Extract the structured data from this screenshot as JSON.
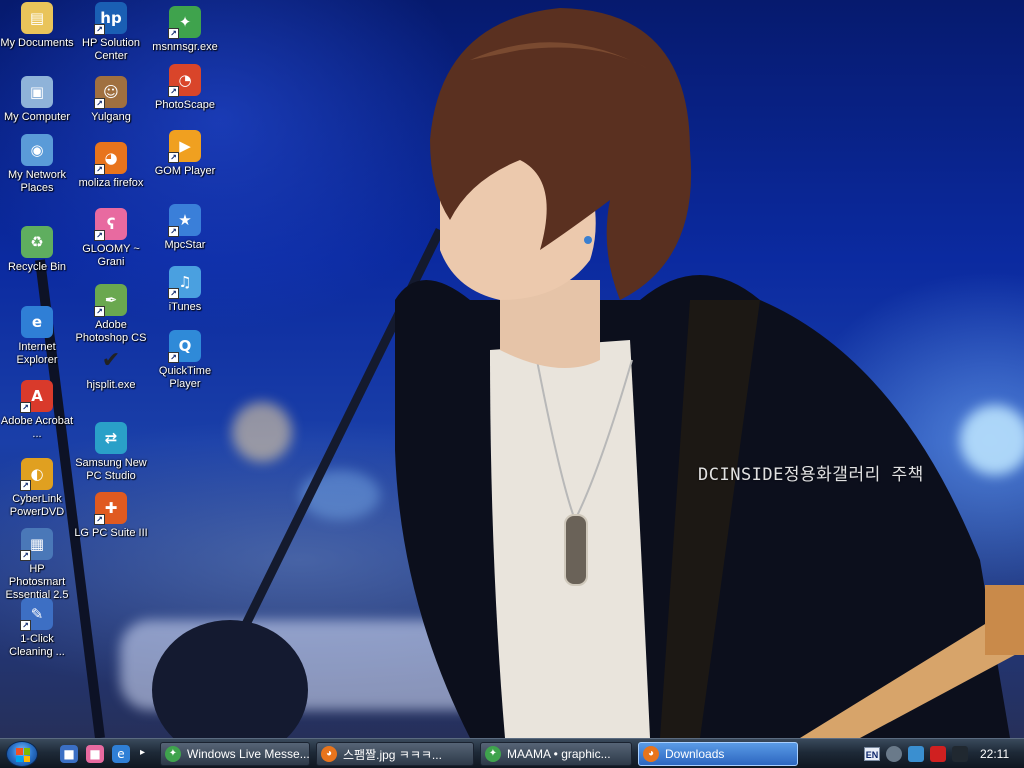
{
  "desktop": {
    "watermark": "DCINSIDE정용화갤러리 주책",
    "icons": [
      {
        "label": "My Documents",
        "icon": "folder-document-icon",
        "color": "#e9c45a",
        "shortcut": false
      },
      {
        "label": "My Computer",
        "icon": "computer-icon",
        "color": "#8fb3d9",
        "shortcut": false
      },
      {
        "label": "My Network Places",
        "icon": "network-icon",
        "color": "#5a9bd8",
        "shortcut": false
      },
      {
        "label": "Recycle Bin",
        "icon": "recycle-bin-icon",
        "color": "#5fae5f",
        "shortcut": false
      },
      {
        "label": "Internet Explorer",
        "icon": "internet-explorer-icon",
        "color": "#2f7fd6",
        "shortcut": false
      },
      {
        "label": "Adobe Acrobat ...",
        "icon": "acrobat-icon",
        "color": "#d93a2b",
        "shortcut": true
      },
      {
        "label": "CyberLink PowerDVD",
        "icon": "powerdvd-icon",
        "color": "#e0a020",
        "shortcut": true
      },
      {
        "label": "HP Photosmart Essential 2.5",
        "icon": "hp-photosmart-icon",
        "color": "#4a78b8",
        "shortcut": true
      },
      {
        "label": "1-Click Cleaning ...",
        "icon": "cleaning-brush-icon",
        "color": "#3d6fc4",
        "shortcut": true
      },
      {
        "label": "HP Solution Center",
        "icon": "hp-logo-icon",
        "color": "#1a5fb4",
        "shortcut": true
      },
      {
        "label": "Yulgang",
        "icon": "game-character-icon",
        "color": "#a07040",
        "shortcut": true
      },
      {
        "label": "moliza firefox",
        "icon": "firefox-icon",
        "color": "#e8741c",
        "shortcut": true
      },
      {
        "label": "GLOOMY ~ Grani",
        "icon": "pink-bear-icon",
        "color": "#e86aa0",
        "shortcut": true
      },
      {
        "label": "Adobe Photoshop CS",
        "icon": "photoshop-feather-icon",
        "color": "#6aa84f",
        "shortcut": true
      },
      {
        "label": "hjsplit.exe",
        "icon": "checkmark-icon",
        "color": "#222222",
        "shortcut": false
      },
      {
        "label": "Samsung New PC Studio",
        "icon": "samsung-pc-studio-icon",
        "color": "#2aa0c8",
        "shortcut": false
      },
      {
        "label": "LG PC Suite III",
        "icon": "lg-pc-suite-icon",
        "color": "#e05a20",
        "shortcut": true
      },
      {
        "label": "msnmsgr.exe",
        "icon": "msn-messenger-icon",
        "color": "#3fa34d",
        "shortcut": true
      },
      {
        "label": "PhotoScape",
        "icon": "photoscape-icon",
        "color": "#d9452a",
        "shortcut": true
      },
      {
        "label": "GOM Player",
        "icon": "gom-player-icon",
        "color": "#f0a020",
        "shortcut": true
      },
      {
        "label": "MpcStar",
        "icon": "mpcstar-icon",
        "color": "#3a7fd9",
        "shortcut": true
      },
      {
        "label": "iTunes",
        "icon": "itunes-icon",
        "color": "#4aa0e0",
        "shortcut": true
      },
      {
        "label": "QuickTime Player",
        "icon": "quicktime-icon",
        "color": "#2f8ad8",
        "shortcut": true
      }
    ]
  },
  "taskbar": {
    "start_icon": "windows-orb-icon",
    "quick_launch": [
      {
        "icon": "show-desktop-icon",
        "color": "#3b6fc4"
      },
      {
        "icon": "gloomy-bear-icon",
        "color": "#e86aa0"
      },
      {
        "icon": "internet-explorer-icon",
        "color": "#2f7fd6"
      }
    ],
    "overflow_glyph": "▸",
    "tasks": [
      {
        "label": "Windows Live Messe...",
        "icon": "msn-messenger-icon",
        "color": "#3fa34d",
        "active": false
      },
      {
        "label": "스팸짤.jpg ㅋㅋㅋ...",
        "icon": "firefox-icon",
        "color": "#e8741c",
        "active": false
      },
      {
        "label": "MAAMA • graphic...",
        "icon": "msn-messenger-icon",
        "color": "#3fa34d",
        "active": false
      },
      {
        "label": "Downloads",
        "icon": "firefox-icon",
        "color": "#e8741c",
        "active": true
      }
    ],
    "tray": {
      "language": "EN",
      "icons": [
        {
          "icon": "volume-dial-icon",
          "color": "#6a7a8a"
        },
        {
          "icon": "network-connection-icon",
          "color": "#3a8fd0"
        },
        {
          "icon": "avira-umbrella-icon",
          "color": "#d02020"
        },
        {
          "icon": "signal-icon",
          "color": "#202830"
        }
      ],
      "clock": "22:11"
    }
  }
}
